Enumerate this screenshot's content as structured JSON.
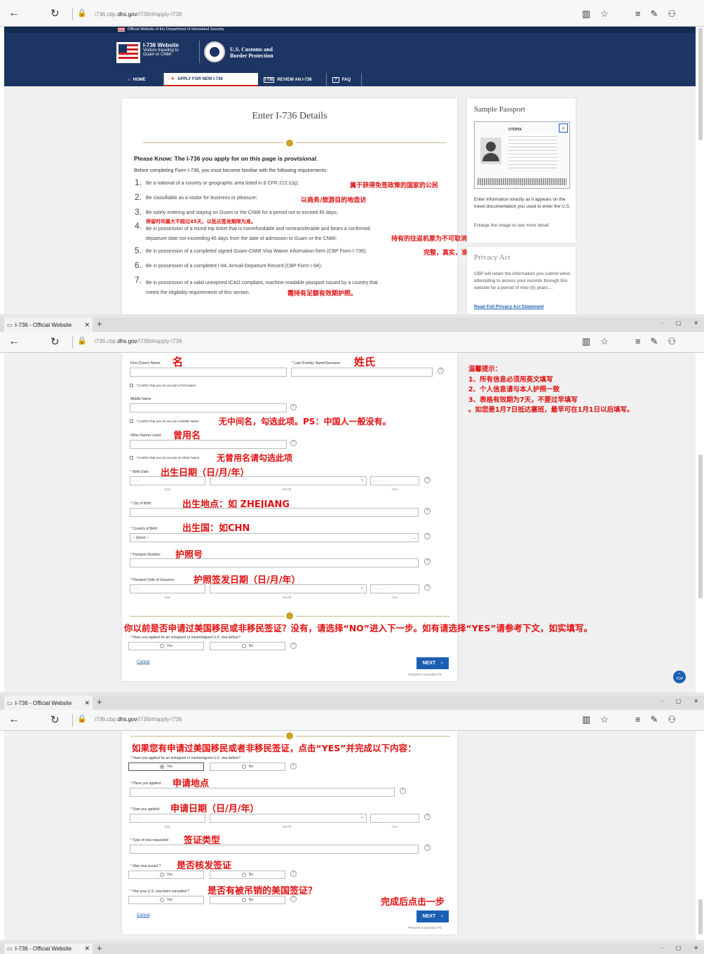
{
  "browser": {
    "tab_title": "I-736 - Official Website",
    "url_prefix": "i736.cbp.",
    "url_domain": "dhs.gov",
    "url_path": "/I736/#/apply-I736",
    "win_controls": [
      "-",
      "▢",
      "✕"
    ]
  },
  "site": {
    "gov_banner": "Official Website of the Department of Homeland Security",
    "site_name": "I-736 Website",
    "site_sub1": "Visitors traveling to",
    "site_sub2": "Guam or CNMI",
    "agency1": "U.S. Customs and",
    "agency2": "Border Protection",
    "nav": [
      "HOME",
      "APPLY FOR NEW I-736",
      "REVIEW AN I-736",
      "FAQ"
    ]
  },
  "page1": {
    "title": "Enter I-736 Details",
    "please_know": "Please Know: The I-736 you apply for on this page is",
    "provisional": "provisional.",
    "before": "Before completing Form I-736, you must become familiar with the following requirements:",
    "requirements": [
      {
        "n": "1.",
        "text": "Be a national of a country or geographic area listed in 8 CFR 212.1(q);"
      },
      {
        "n": "2.",
        "text": "Be classifiable as a visitor for business or pleasure;"
      },
      {
        "n": "3.",
        "text": "Be solely entering and staying on Guam or the CNMI for a period not to exceed 45 days;"
      },
      {
        "n": "4.",
        "text": "Be in possession of a round trip ticket that is nonrefundable and nontransferable and bears a confirmed",
        "text2": "departure date not exceeding 45 days from the date of admission to Guam or the CNMI;"
      },
      {
        "n": "5.",
        "text": "Be in possession of a completed signed Guam-CNMI Visa Waiver information form (CBP Form I-736);"
      },
      {
        "n": "6.",
        "text": "Be in possession of a completed I-94, Arrival-Departure Record (CBP Form I-94);"
      },
      {
        "n": "7.",
        "text": "Be in possession of a valid unexpired ICAO compliant, machine readable passport issued by a country that",
        "text2": "meets the eligibility requirements of this section."
      }
    ],
    "notes": [
      "属于获得免签政策的国家的公民",
      "以商务/旅游目的地造访",
      "停留时间最大不超过45天，以抵达签发期限为准。",
      "持有的往返机票为不可取消和签转。",
      "完整，真实，准确填写表格内容",
      "需持有足额有效期护照。"
    ],
    "sample_title": "Sample Passport",
    "sample_text": "Enter information exactly as it appears on the travel documentation you used to enter the U.S.",
    "sample_enlarge": "Enlarge the image to see more detail.",
    "passport_country": "UTOPIA",
    "privacy_title": "Privacy Act",
    "privacy_text": "CBP will retain the information you submit when attempting to access your records through this website for a period of nine (9) years....",
    "privacy_link": "Read Full Privacy Act Statement"
  },
  "page2": {
    "first_name": "First (Given) Name:",
    "last_name": "* Last (Family) Name/Surname:",
    "confirm_first": "* Confirm that you do not use a First Name",
    "middle": "Middle Name:",
    "confirm_middle": "* Confirm that you do not use a Middle Name",
    "other": "Other Names Used:",
    "confirm_other": "* Confirm that you do not use an Other Name",
    "birth": "* Birth Date:",
    "city": "* City of Birth:",
    "country": "* Country of Birth:",
    "select": "-- Select --",
    "passport": "* Passport Number:",
    "issuance": "* Passport Date of Issuance:",
    "day": "Day",
    "month": "Month",
    "year": "Year",
    "date_ph": "-- --",
    "year_ph": "-- -- -- --",
    "applied_q": "* Have you applied for an immigrant or nonimmigrant U.S. visa before?",
    "yes": "Yes",
    "no": "No",
    "cancel": "Cancel",
    "next": "NEXT",
    "proceed": "Proceed to Question #9.",
    "top": "TOP",
    "notes": {
      "given": "名",
      "family": "姓氏",
      "middle": "无中间名，勾选此项。PS：中国人一般没有。",
      "other": "曾用名",
      "other_none": "无曾用名请勾选此项",
      "birth": "出生日期（日/月/年）",
      "city": "出生地点：如 ZHEJIANG",
      "country": "出生国：如CHN",
      "passport": "护照号",
      "issuance": "护照签发日期（日/月/年）",
      "applied": "你以前是否申请过美国移民或非移民签证？没有，请选择“NO”进入下一步。如有请选择“YES”请参考下文，如实填写。"
    },
    "tips": [
      "温馨提示：",
      "1、所有信息必须用英文填写",
      "2、个人信息请与本人护照一致",
      "3、表格有效期为7天，不要过早填写",
      "。如您是1月7日抵达塞班，最早可在1月1日以后填写。"
    ]
  },
  "page3": {
    "applied_q": "* Have you applied for an immigrant or nonimmigrant U.S. visa before?",
    "place": "* Place you applied:",
    "date": "* Date you applied:",
    "type": "* Type of visa requested:",
    "issued": "* Was visa issued ?",
    "cancelled": "* Has your U.S. visa been cancelled ?",
    "notes": {
      "intro": "如果您有申请过美国移民或者非移民签证，点击“YES”并完成以下内容：",
      "place": "申请地点",
      "date": "申请日期（日/月/年）",
      "type": "签证类型",
      "issued": "是否核发签证",
      "cancelled": "是否有被吊销的美国签证？",
      "done": "完成后点击一步"
    }
  }
}
